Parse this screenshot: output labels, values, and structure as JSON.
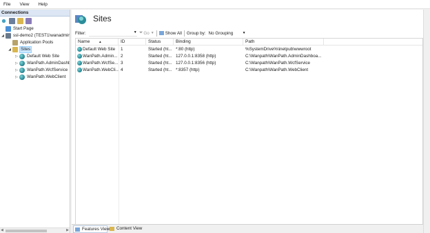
{
  "menu": [
    "File",
    "View",
    "Help"
  ],
  "connections": {
    "header": "Connections",
    "tree": [
      {
        "label": "Start Page",
        "level": 0,
        "expander": "",
        "icon": "start-page-icon"
      },
      {
        "label": "ssl-demo2 (TEST1\\wanadmin",
        "level": 0,
        "expander": "◢",
        "icon": "server-icon"
      },
      {
        "label": "Application Pools",
        "level": 1,
        "expander": "",
        "icon": "app-pools-icon"
      },
      {
        "label": "Sites",
        "level": 1,
        "expander": "◢",
        "icon": "sites-folder-icon",
        "selected": true
      },
      {
        "label": "Default Web Site",
        "level": 2,
        "expander": "▷",
        "icon": "globe-icon"
      },
      {
        "label": "WanPath.AdminDashb",
        "level": 2,
        "expander": "▷",
        "icon": "globe-icon"
      },
      {
        "label": "WanPath.WcfService",
        "level": 2,
        "expander": "▷",
        "icon": "globe-icon"
      },
      {
        "label": "WanPath.WebClient",
        "level": 2,
        "expander": "▷",
        "icon": "globe-icon"
      }
    ]
  },
  "main": {
    "title": "Sites",
    "filter_label": "Filter:",
    "go_label": "Go",
    "show_all_label": "Show All",
    "group_by_label": "Group by:",
    "group_by_value": "No Grouping",
    "columns": [
      "Name",
      "ID",
      "Status",
      "Binding",
      "Path"
    ],
    "sort_indicator": "▲",
    "rows": [
      {
        "name": "Default Web Site",
        "id": "1",
        "status": "Started (ht...",
        "binding": "*:80 (http)",
        "path": "%SystemDrive%\\inetpub\\wwwroot"
      },
      {
        "name": "WanPath.Admin...",
        "id": "2",
        "status": "Started (ht...",
        "binding": "127.0.0.1:8358 (http)",
        "path": "C:\\Wanpath\\WanPath.AdminDashboa..."
      },
      {
        "name": "WanPath.WcfSe...",
        "id": "3",
        "status": "Started (ht...",
        "binding": "127.0.0.1:8356 (http)",
        "path": "C:\\Wanpath\\WanPath.WcfService"
      },
      {
        "name": "WanPath.WebCli...",
        "id": "4",
        "status": "Started (ht...",
        "binding": "*:8357 (http)",
        "path": "C:\\Wanpath\\WanPath.WebClient"
      }
    ],
    "tabs": [
      "Features View",
      "Content View"
    ]
  }
}
